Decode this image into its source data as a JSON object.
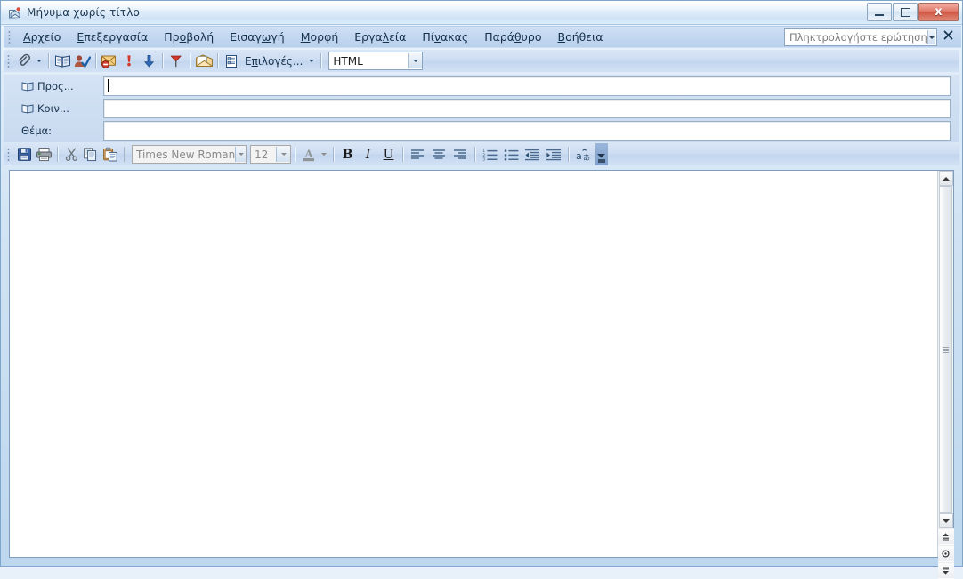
{
  "window": {
    "title": "Μήνυμα χωρίς τίτλο",
    "icon": "message-envelope-icon",
    "buttons": {
      "minimize": "–",
      "maximize": "□",
      "close": "x"
    }
  },
  "menubar": {
    "grip": "toolbar-grip",
    "items": [
      {
        "label": "Αρχείο",
        "pre": "",
        "key": "Α",
        "post": "ρχείο"
      },
      {
        "label": "Επεξεργασία",
        "pre": "",
        "key": "Ε",
        "post": "πεξεργασία"
      },
      {
        "label": "Προβολή",
        "pre": "Πρ",
        "key": "ο",
        "post": "βολή"
      },
      {
        "label": "Εισαγωγή",
        "pre": "Εισαγ",
        "key": "ω",
        "post": "γή"
      },
      {
        "label": "Μορφή",
        "pre": "",
        "key": "Μ",
        "post": "ορφή"
      },
      {
        "label": "Εργαλεία",
        "pre": "Εργα",
        "key": "λ",
        "post": "εία"
      },
      {
        "label": "Πίνακας",
        "pre": "Πί",
        "key": "ν",
        "post": "ακας"
      },
      {
        "label": "Παράθυρο",
        "pre": "Παρά",
        "key": "θ",
        "post": "υρο"
      },
      {
        "label": "Βοήθεια",
        "pre": "",
        "key": "Β",
        "post": "οήθεια"
      }
    ],
    "ask_box": {
      "placeholder": "Πληκτρολογήστε ερώτηση",
      "value": "",
      "dropdown_icon": "chevron-down-icon"
    },
    "close_label": "✕"
  },
  "toolbar_standard": {
    "grip": "toolbar-grip",
    "items": [
      {
        "name": "attach-file-button",
        "icon": "paperclip-icon"
      },
      {
        "name": "attach-file-dropdown",
        "icon": "chevron-down-icon"
      },
      {
        "name": "address-book-button",
        "icon": "address-book-icon"
      },
      {
        "name": "check-names-button",
        "icon": "check-names-icon"
      },
      {
        "name": "block-sender-button",
        "icon": "envelope-blocked-icon"
      },
      {
        "name": "high-importance-button",
        "icon": "exclamation-red-icon"
      },
      {
        "name": "low-importance-button",
        "icon": "arrow-down-blue-icon"
      },
      {
        "name": "follow-up-flag-button",
        "icon": "flag-red-icon"
      },
      {
        "name": "open-folder-button",
        "icon": "open-envelope-icon"
      },
      {
        "name": "options-button",
        "icon": "options-list-icon"
      }
    ],
    "options_label": "Επιλογές...",
    "options_pre": "Ε",
    "options_key": "π",
    "options_post": "ιλογές...",
    "options_dropdown_icon": "chevron-down-icon",
    "format_combo": {
      "name": "message-format-combo",
      "value": "HTML",
      "dropdown_icon": "chevron-down-icon"
    }
  },
  "headers": {
    "to": {
      "label": "Προς...",
      "icon": "address-book-icon",
      "value": ""
    },
    "cc": {
      "label": "Κοιν...",
      "icon": "address-book-icon",
      "value": ""
    },
    "subject": {
      "label": "Θέμα:",
      "value": ""
    }
  },
  "toolbar_formatting": {
    "grip": "toolbar-grip",
    "items": [
      {
        "name": "save-button",
        "icon": "floppy-disk-icon"
      },
      {
        "name": "print-button",
        "icon": "printer-icon"
      },
      {
        "name": "cut-button",
        "icon": "scissors-icon"
      },
      {
        "name": "copy-button",
        "icon": "copy-icon"
      },
      {
        "name": "paste-button",
        "icon": "clipboard-paste-icon"
      }
    ],
    "font_combo": {
      "name": "font-family-combo",
      "value": "Times New Roman",
      "dropdown_icon": "chevron-down-icon"
    },
    "size_combo": {
      "name": "font-size-combo",
      "value": "12",
      "dropdown_icon": "chevron-down-icon"
    },
    "font_color": {
      "name": "font-color-button",
      "label": "A",
      "icon": "font-color-icon",
      "swatch": "#8a8a8a",
      "dropdown_icon": "chevron-down-icon"
    },
    "bold": {
      "name": "bold-button",
      "label": "B"
    },
    "italic": {
      "name": "italic-button",
      "label": "I"
    },
    "underline": {
      "name": "underline-button",
      "label": "U"
    },
    "align": [
      {
        "name": "align-left-button",
        "icon": "align-left-icon"
      },
      {
        "name": "align-center-button",
        "icon": "align-center-icon"
      },
      {
        "name": "align-right-button",
        "icon": "align-right-icon"
      }
    ],
    "lists": [
      {
        "name": "numbered-list-button",
        "icon": "numbered-list-icon"
      },
      {
        "name": "bulleted-list-button",
        "icon": "bulleted-list-icon"
      }
    ],
    "indent": [
      {
        "name": "decrease-indent-button",
        "icon": "decrease-indent-icon"
      },
      {
        "name": "increase-indent-button",
        "icon": "increase-indent-icon"
      }
    ],
    "phonetic": {
      "name": "phonetic-guide-button",
      "icon": "phonetic-guide-icon",
      "label": "aあ"
    },
    "overflow": {
      "name": "toolbar-overflow-button",
      "icon": "toolbar-options-icon"
    }
  },
  "editor": {
    "name": "message-body-editor",
    "content": ""
  },
  "scrollbar": {
    "up": {
      "name": "scroll-up-button",
      "icon": "triangle-up-icon"
    },
    "down": {
      "name": "scroll-down-button",
      "icon": "triangle-down-icon"
    },
    "thumb": {
      "name": "scroll-thumb",
      "icon": "scroll-grip-icon"
    },
    "prev_page": {
      "name": "previous-page-button",
      "icon": "double-arrow-up-icon"
    },
    "browse_object": {
      "name": "select-browse-object-button",
      "icon": "browse-object-circle-icon"
    },
    "next_page": {
      "name": "next-page-button",
      "icon": "double-arrow-down-icon"
    }
  },
  "colors": {
    "titlebar": "#dceafa",
    "toolbar": "#ccdcf1",
    "header_panel": "#cedef2",
    "accent_blue": "#1d3e66",
    "close_red": "#cf5744",
    "field_white": "#ffffff"
  }
}
